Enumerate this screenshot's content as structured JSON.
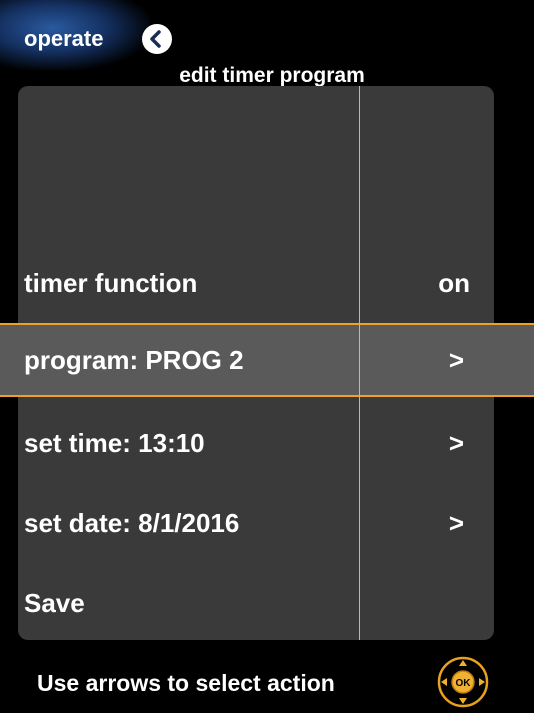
{
  "header": {
    "operate_label": "operate",
    "title": "edit timer program"
  },
  "rows": [
    {
      "label": "timer function",
      "value": "on"
    },
    {
      "label": "program: PROG 2",
      "value": ">"
    },
    {
      "label": "set time: 13:10",
      "value": ">"
    },
    {
      "label": "set date: 8/1/2016",
      "value": ">"
    },
    {
      "label": "Save",
      "value": ""
    }
  ],
  "footer": {
    "hint": "Use arrows to select action"
  },
  "colors": {
    "accent": "#f0a024",
    "panel": "#3a3a3a",
    "selected_row": "#5a5a5a"
  },
  "icons": {
    "back": "chevron-left-icon",
    "nav": "ok-dpad-icon"
  }
}
